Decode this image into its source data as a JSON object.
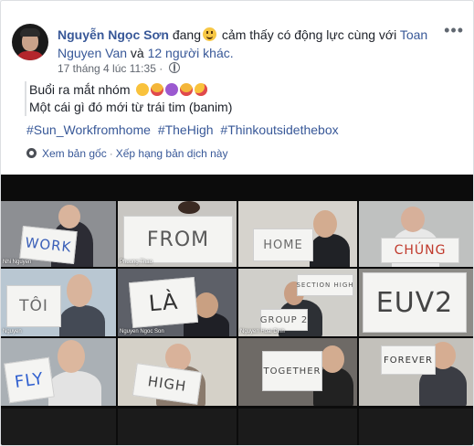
{
  "post": {
    "author": "Nguyễn Ngọc Sơn",
    "feeling_prefix": "đang",
    "feeling_text": "cảm thấy có động lực cùng với",
    "with_name": "Toan Nguyen Van",
    "with_conj": "và",
    "with_others": "12 người khác.",
    "timestamp": "17 tháng 4 lúc 11:35",
    "timestamp_sep": "·",
    "more_label": "•••",
    "line1": "Buổi ra mắt nhóm",
    "line2": "Một cái gì đó mới từ trái tim (banim)",
    "hashtags": [
      "#Sun_Workfromhome",
      "#TheHigh",
      "#Thinkoutsidethebox"
    ],
    "see_original": "Xem bản gốc",
    "rate_translation": "Xếp hạng bản dịch này",
    "sep": "·"
  },
  "icons": {
    "feeling": "smile-emoji-icon",
    "privacy": "globe-icon",
    "translate": "gear-icon",
    "reactions": [
      "party-face-emoji",
      "heart-eyes-emoji",
      "star-struck-emoji",
      "heart-eyes-emoji",
      "kiss-emoji"
    ]
  },
  "photo": {
    "tiles": [
      {
        "sign": "WORK",
        "name": "Nhi Nguyen"
      },
      {
        "sign": "FROM",
        "name": "Phuong Thao"
      },
      {
        "sign": "HOME",
        "name": ""
      },
      {
        "sign": "CHÚNG",
        "name": ""
      },
      {
        "sign": "TÔI",
        "name": "Nguyen"
      },
      {
        "sign": "LÀ",
        "name": "Nguyen Ngoc Son"
      },
      {
        "sign": "GROUP 2",
        "name": "Nguyen Hoai Dinh"
      },
      {
        "sign": "EUV2",
        "name": ""
      },
      {
        "sign": "FLY",
        "name": ""
      },
      {
        "sign": "HIGH",
        "name": ""
      },
      {
        "sign": "TOGETHER",
        "name": ""
      },
      {
        "sign": "FOREVER",
        "name": ""
      }
    ]
  },
  "colors": {
    "link": "#385898",
    "text": "#1d2129",
    "meta": "#616770"
  }
}
